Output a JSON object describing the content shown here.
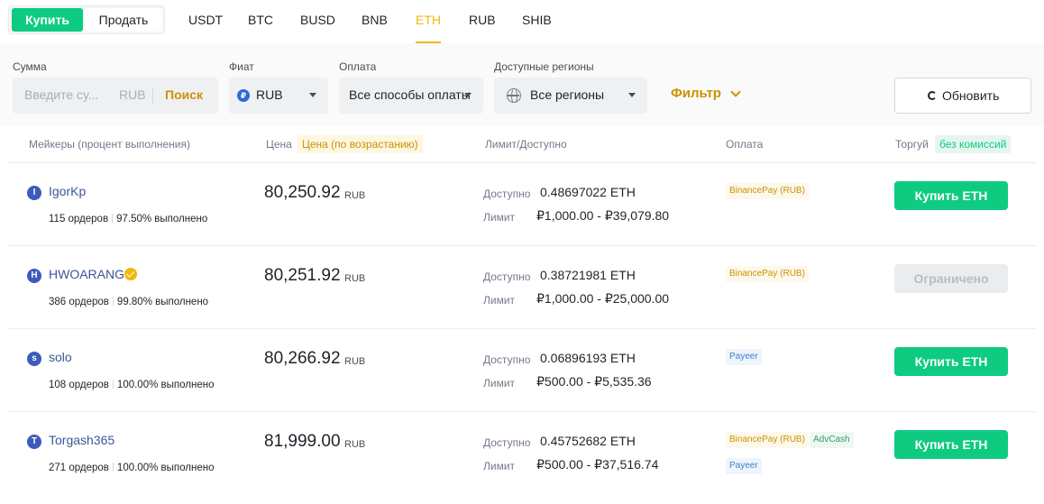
{
  "trade_switch": {
    "buy": "Купить",
    "sell": "Продать"
  },
  "asset_tabs": [
    {
      "label": "USDT",
      "active": false
    },
    {
      "label": "BTC",
      "active": false
    },
    {
      "label": "BUSD",
      "active": false
    },
    {
      "label": "BNB",
      "active": false
    },
    {
      "label": "ETH",
      "active": true
    },
    {
      "label": "RUB",
      "active": false
    },
    {
      "label": "SHIB",
      "active": false
    }
  ],
  "filters": {
    "amount_label": "Сумма",
    "amount_placeholder": "Введите су...",
    "amount_currency": "RUB",
    "search_button": "Поиск",
    "fiat_label": "Фиат",
    "fiat_value": "RUB",
    "fiat_icon": "₽",
    "payment_label": "Оплата",
    "payment_value": "Все способы оплаты",
    "regions_label": "Доступные регионы",
    "regions_value": "Все регионы",
    "filter_button": "Фильтр",
    "refresh_button": "Обновить"
  },
  "table_header": {
    "makers": "Мейкеры (процент выполнения)",
    "price": "Цена",
    "price_sort_tag": "Цена (по возрастанию)",
    "limit": "Лимит/Доступно",
    "payment": "Оплата",
    "trade": "Торгуй",
    "trade_tag": "без комиссий"
  },
  "colors": {
    "buy_green": "#0ecb81",
    "accent_yellow": "#f0b90b",
    "maker_link": "#3a5795"
  },
  "rows": [
    {
      "initial": "I",
      "name": "IgorKp",
      "verified": false,
      "orders": "115 ордеров",
      "completion": "97.50% выполнено",
      "price": "80,250.92",
      "price_currency": "RUB",
      "available_label": "Доступно",
      "available": "0.48697022 ETH",
      "limit_label": "Лимит",
      "limit": "₽1,000.00 - ₽39,079.80",
      "payments": [
        "BinancePay (RUB)"
      ],
      "action": "Купить ETH",
      "action_enabled": true
    },
    {
      "initial": "H",
      "name": "HWOARANG",
      "verified": true,
      "orders": "386 ордеров",
      "completion": "99.80% выполнено",
      "price": "80,251.92",
      "price_currency": "RUB",
      "available_label": "Доступно",
      "available": "0.38721981 ETH",
      "limit_label": "Лимит",
      "limit": "₽1,000.00 - ₽25,000.00",
      "payments": [
        "BinancePay (RUB)"
      ],
      "action": "Ограничено",
      "action_enabled": false
    },
    {
      "initial": "s",
      "name": "solo",
      "verified": false,
      "orders": "108 ордеров",
      "completion": "100.00% выполнено",
      "price": "80,266.92",
      "price_currency": "RUB",
      "available_label": "Доступно",
      "available": "0.06896193 ETH",
      "limit_label": "Лимит",
      "limit": "₽500.00 - ₽5,535.36",
      "payments": [
        "Payeer"
      ],
      "action": "Купить ETH",
      "action_enabled": true
    },
    {
      "initial": "T",
      "name": "Torgash365",
      "verified": false,
      "orders": "271 ордеров",
      "completion": "100.00% выполнено",
      "price": "81,999.00",
      "price_currency": "RUB",
      "available_label": "Доступно",
      "available": "0.45752682 ETH",
      "limit_label": "Лимит",
      "limit": "₽500.00 - ₽37,516.74",
      "payments": [
        "BinancePay (RUB)",
        "AdvCash",
        "Payeer"
      ],
      "action": "Купить ETH",
      "action_enabled": true
    }
  ]
}
